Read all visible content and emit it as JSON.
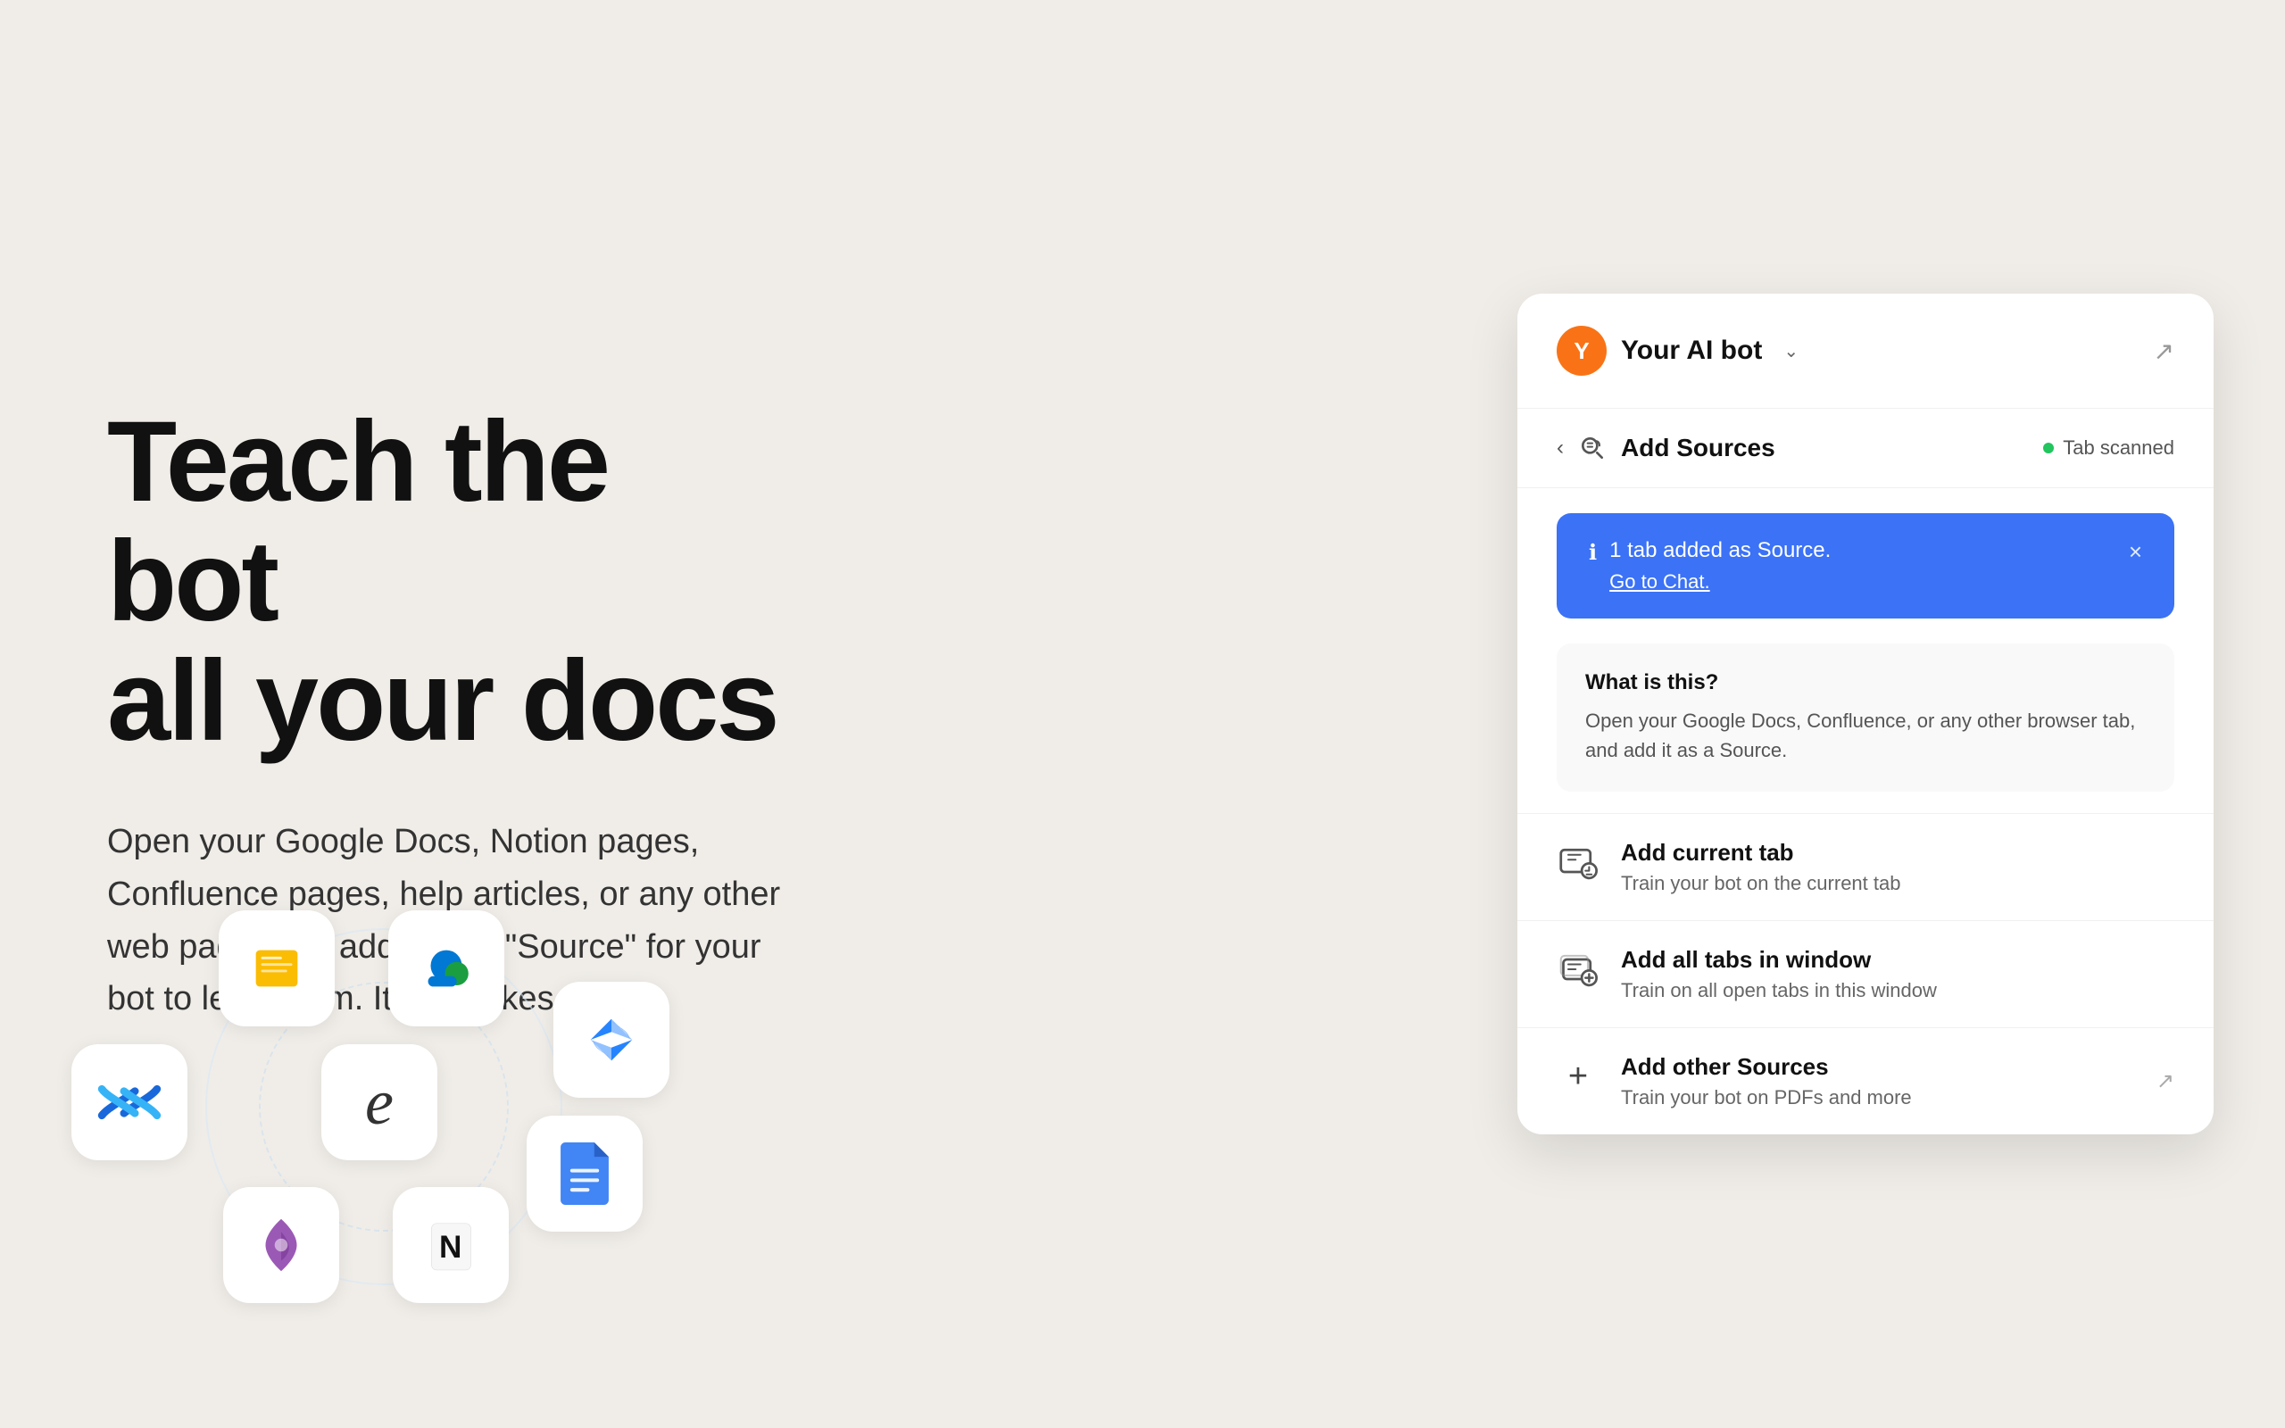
{
  "headline": "Teach the bot\nall your docs",
  "subtext": "Open your Google Docs, Notion pages, Confluence pages, help articles, or any other web page, and add it as a \"Source\" for your bot to learn from. It only takes a click.",
  "panel": {
    "bot_name": "Your AI bot",
    "bot_initial": "Y",
    "add_sources_label": "Add Sources",
    "tab_scanned": "Tab scanned",
    "back_label": "back",
    "external_link_label": "open"
  },
  "notification": {
    "main_text": "1 tab added as Source.",
    "link_text": "Go to Chat.",
    "close_label": "×"
  },
  "what_section": {
    "title": "What is this?",
    "description": "Open your Google Docs, Confluence, or any other browser tab, and add it as a Source."
  },
  "actions": [
    {
      "title": "Add current tab",
      "subtitle": "Train your bot on the current tab",
      "has_external": false
    },
    {
      "title": "Add all tabs in window",
      "subtitle": "Train on all open tabs in this window",
      "has_external": false
    },
    {
      "title": "Add other Sources",
      "subtitle": "Train your bot on PDFs and more",
      "has_external": true
    }
  ],
  "app_icons": [
    {
      "name": "google-slides",
      "label": "Google Slides"
    },
    {
      "name": "sharepoint",
      "label": "SharePoint"
    },
    {
      "name": "jira",
      "label": "Jira"
    },
    {
      "name": "confluence",
      "label": "Confluence"
    },
    {
      "name": "edge",
      "label": "Edge"
    },
    {
      "name": "google-docs",
      "label": "Google Docs"
    },
    {
      "name": "designmaker",
      "label": "Designmaker"
    },
    {
      "name": "notion",
      "label": "Notion"
    }
  ]
}
